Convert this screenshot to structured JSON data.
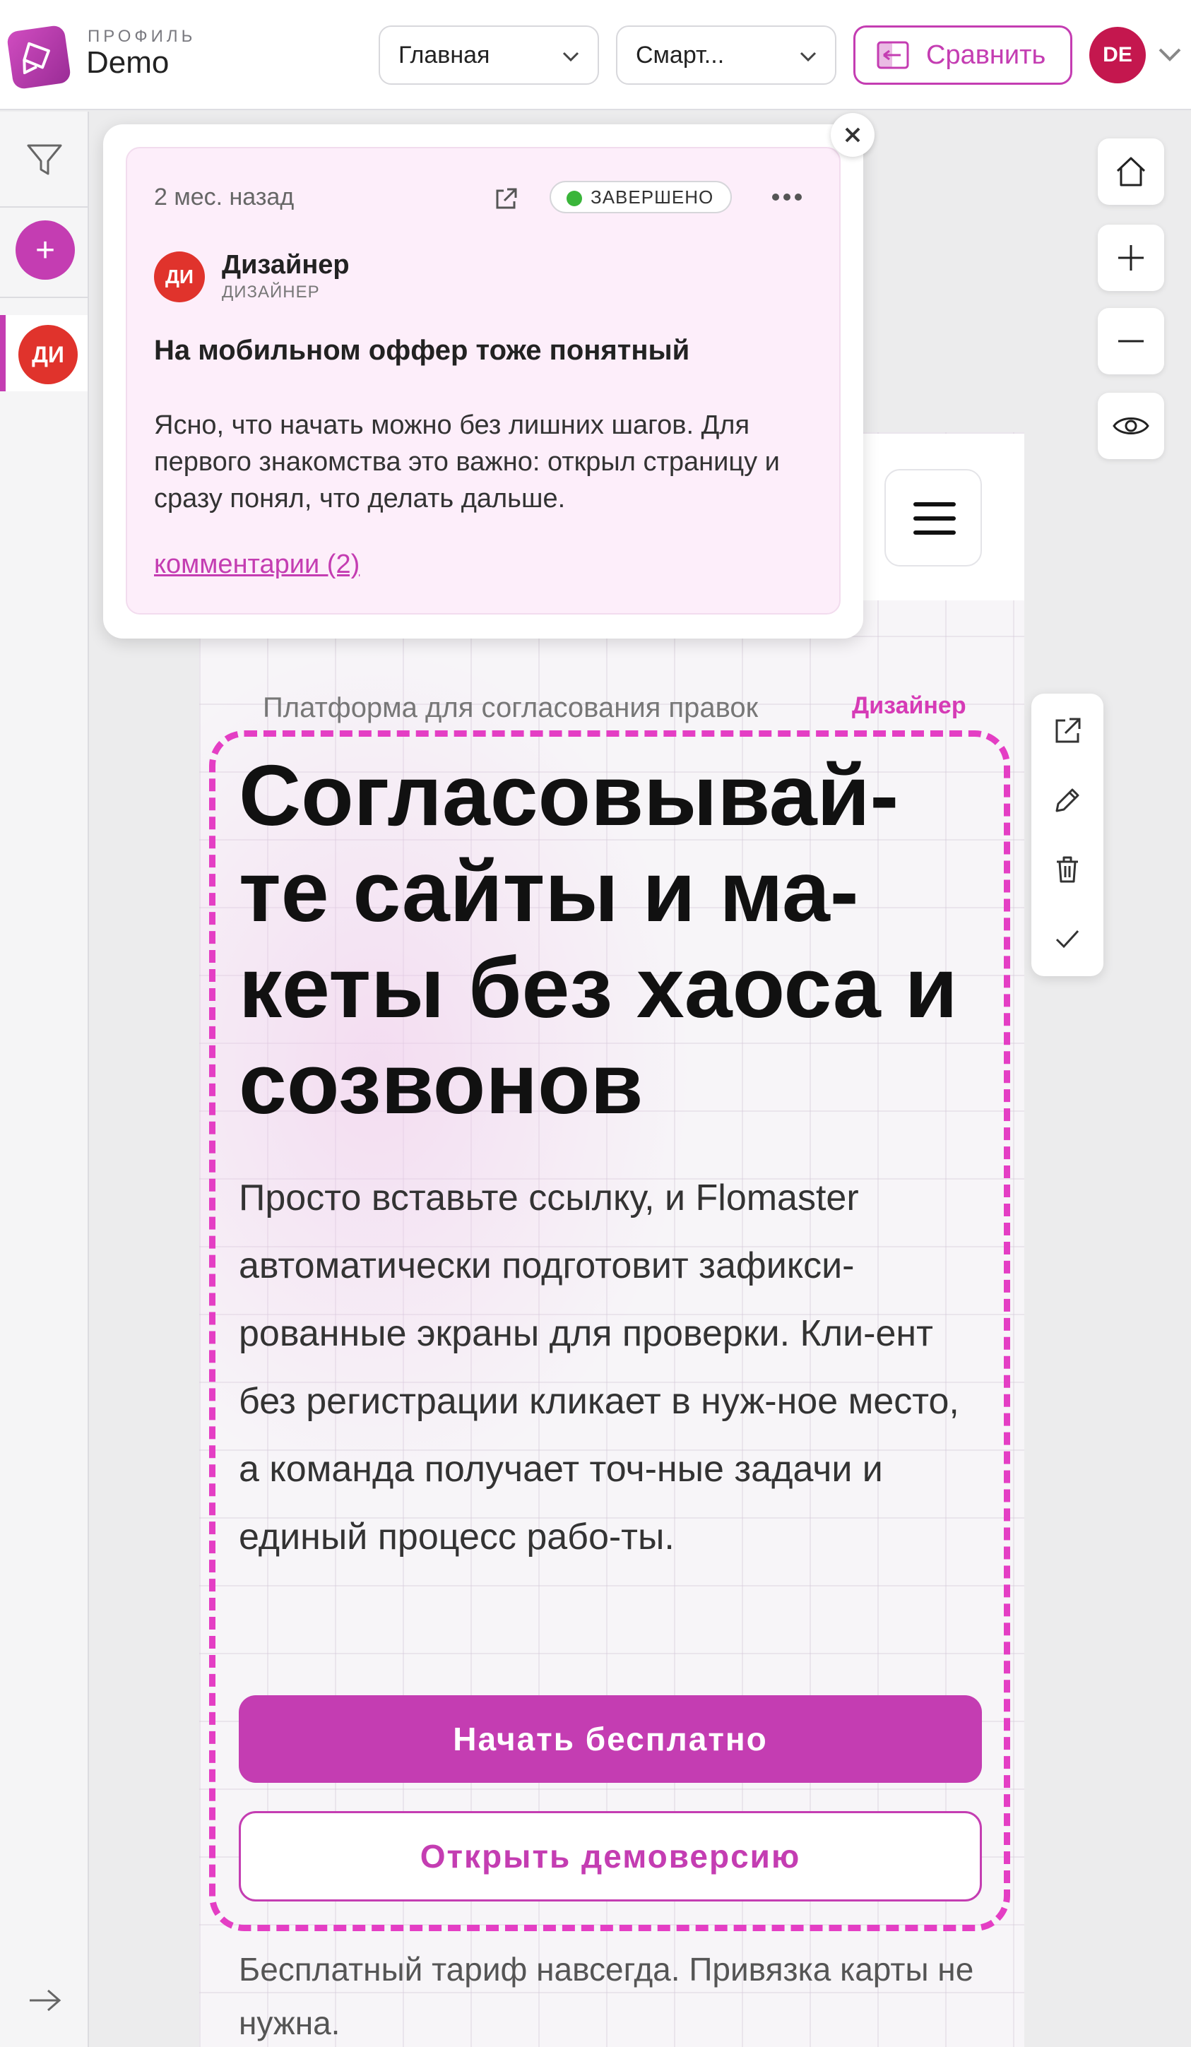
{
  "header": {
    "profile_label": "ПРОФИЛЬ",
    "profile_name": "Demo",
    "page_select": "Главная",
    "device_select": "Смарт...",
    "compare_label": "Сравнить",
    "user_initials": "DE"
  },
  "sidebar": {
    "add_label": "+",
    "reviewer_initials": "ДИ"
  },
  "comment": {
    "time": "2 мес. назад",
    "status": "ЗАВЕРШЕНО",
    "author_initials": "ДИ",
    "author_name": "Дизайнер",
    "author_role": "ДИЗАЙНЕР",
    "title": "На мобильном оффер тоже понятный",
    "body": "Ясно, что начать можно без лишних шагов. Для первого знакомства это важно: открыл страницу и сразу понял, что делать дальше.",
    "comments_link": "комментарии (2)"
  },
  "preview": {
    "eyebrow": "Платформа для согласования правок",
    "pin_author": "Дизайнер",
    "hero_title": "Согласовывай-те сайты и ма-кеты без хаоса и созвонов",
    "hero_text": "Просто вставьте ссылку, и Flomaster автоматически подготовит зафикси-рованные экраны для проверки. Кли-ент без регистрации кликает в нуж-ное место, а команда получает точ-ные задачи и единый процесс рабо-ты.",
    "primary_cta": "Начать бесплатно",
    "secondary_cta": "Открыть демоверсию",
    "note": "Бесплатный тариф навсегда. Привязка карты не нужна."
  },
  "icons": {
    "filter": "filter-icon",
    "home": "home-icon",
    "zoom_in": "plus-icon",
    "zoom_out": "minus-icon",
    "visibility": "eye-icon",
    "open": "external-link-icon",
    "edit": "pencil-icon",
    "delete": "trash-icon",
    "resolve": "check-icon"
  },
  "colors": {
    "accent": "#c43db2",
    "selection": "#e43ec4",
    "status_done": "#3ab53a",
    "avatar_user": "#c4174e",
    "avatar_reviewer": "#e0332c"
  }
}
